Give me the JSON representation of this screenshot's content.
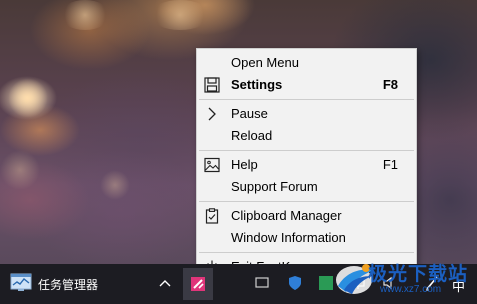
{
  "menu": {
    "open_menu": "Open Menu",
    "settings": "Settings",
    "settings_shortcut": "F8",
    "pause": "Pause",
    "reload": "Reload",
    "help": "Help",
    "help_shortcut": "F1",
    "support_forum": "Support Forum",
    "clipboard_manager": "Clipboard Manager",
    "window_information": "Window Information",
    "exit": "Exit FastKeys"
  },
  "taskbar": {
    "task_manager_label": "任务管理器",
    "ime_label": "中",
    "icons": [
      "task-manager-icon",
      "show-hidden-icons-chevron",
      "fastkeys-tray-icon",
      "network-icon",
      "volume-icon",
      "pen-icon"
    ]
  },
  "watermark": {
    "text": "极光下载站",
    "url": "www.xz7.com"
  },
  "colors": {
    "menu_bg": "#f2f2f2",
    "taskbar_bg": "#1c1c22",
    "watermark_blue": "#1b5fc0",
    "fastkeys_pink": "#e0357a"
  }
}
